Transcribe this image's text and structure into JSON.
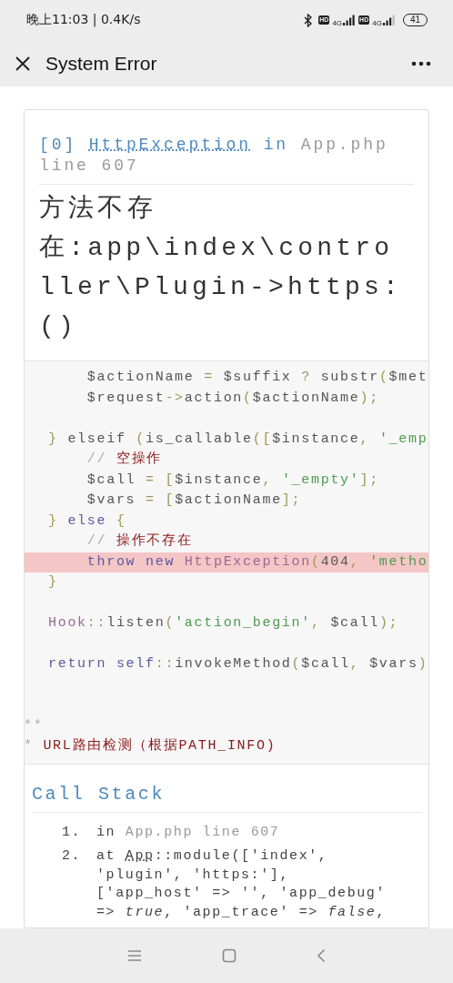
{
  "status_bar": {
    "text": "晚上11:03 | 0.4K/s",
    "sims": [
      {
        "badge": "HD",
        "network": "4G"
      },
      {
        "badge": "HD",
        "network": "4G"
      }
    ],
    "battery": "41"
  },
  "title_bar": {
    "title": "System Error"
  },
  "exception": {
    "index": "[0]",
    "class": "HttpException",
    "connector": "in",
    "location": "App.php line 607"
  },
  "message": "方法不存在:app\\index\\controller\\Plugin->https:()",
  "code": {
    "lines": [
      {
        "highlighted": false,
        "tokens": [
          {
            "kind": "plain",
            "text": "    $actionName"
          },
          {
            "kind": "punct",
            "text": " = "
          },
          {
            "kind": "plain",
            "text": "$suffix"
          },
          {
            "kind": "punct",
            "text": " ? "
          },
          {
            "kind": "plain",
            "text": "substr"
          },
          {
            "kind": "punct",
            "text": "("
          },
          {
            "kind": "plain",
            "text": "$met"
          }
        ]
      },
      {
        "highlighted": false,
        "tokens": [
          {
            "kind": "plain",
            "text": "    $request"
          },
          {
            "kind": "punct",
            "text": "->"
          },
          {
            "kind": "plain",
            "text": "action"
          },
          {
            "kind": "punct",
            "text": "("
          },
          {
            "kind": "plain",
            "text": "$actionName"
          },
          {
            "kind": "punct",
            "text": ");"
          }
        ]
      },
      {
        "highlighted": false
      },
      {
        "highlighted": false,
        "tokens": [
          {
            "kind": "punct",
            "text": "} "
          },
          {
            "kind": "plain",
            "text": "elseif "
          },
          {
            "kind": "punct",
            "text": "("
          },
          {
            "kind": "plain",
            "text": "is_callable"
          },
          {
            "kind": "punct",
            "text": "(["
          },
          {
            "kind": "plain",
            "text": "$instance"
          },
          {
            "kind": "punct",
            "text": ", "
          },
          {
            "kind": "string",
            "text": "'_emp"
          }
        ]
      },
      {
        "highlighted": false,
        "tokens": [
          {
            "kind": "comment_mark",
            "text": "    // "
          },
          {
            "kind": "comment",
            "text": "空操作"
          }
        ]
      },
      {
        "highlighted": false,
        "tokens": [
          {
            "kind": "plain",
            "text": "    $call"
          },
          {
            "kind": "punct",
            "text": " = ["
          },
          {
            "kind": "plain",
            "text": "$instance"
          },
          {
            "kind": "punct",
            "text": ", "
          },
          {
            "kind": "string",
            "text": "'_empty'"
          },
          {
            "kind": "punct",
            "text": "];"
          }
        ]
      },
      {
        "highlighted": false,
        "tokens": [
          {
            "kind": "plain",
            "text": "    $vars"
          },
          {
            "kind": "punct",
            "text": " = ["
          },
          {
            "kind": "plain",
            "text": "$actionName"
          },
          {
            "kind": "punct",
            "text": "];"
          }
        ]
      },
      {
        "highlighted": false,
        "tokens": [
          {
            "kind": "punct",
            "text": "} "
          },
          {
            "kind": "keyword",
            "text": "else"
          },
          {
            "kind": "punct",
            "text": " {"
          }
        ]
      },
      {
        "highlighted": false,
        "tokens": [
          {
            "kind": "comment_mark",
            "text": "    // "
          },
          {
            "kind": "comment",
            "text": "操作不存在"
          }
        ]
      },
      {
        "highlighted": true,
        "tokens": [
          {
            "kind": "keyword",
            "text": "    throw new "
          },
          {
            "kind": "class",
            "text": "HttpException"
          },
          {
            "kind": "punct",
            "text": "("
          },
          {
            "kind": "plain",
            "text": "404"
          },
          {
            "kind": "punct",
            "text": ", "
          },
          {
            "kind": "string",
            "text": "'metho"
          }
        ]
      },
      {
        "highlighted": false,
        "tokens": [
          {
            "kind": "punct",
            "text": "}"
          }
        ]
      },
      {
        "highlighted": false
      },
      {
        "highlighted": false,
        "tokens": [
          {
            "kind": "class",
            "text": "Hook"
          },
          {
            "kind": "punct",
            "text": "::"
          },
          {
            "kind": "plain",
            "text": "listen"
          },
          {
            "kind": "punct",
            "text": "("
          },
          {
            "kind": "string",
            "text": "'action_begin'"
          },
          {
            "kind": "punct",
            "text": ", "
          },
          {
            "kind": "plain",
            "text": "$call"
          },
          {
            "kind": "punct",
            "text": ");"
          }
        ]
      },
      {
        "highlighted": false
      },
      {
        "highlighted": false,
        "tokens": [
          {
            "kind": "keyword",
            "text": "return self"
          },
          {
            "kind": "punct",
            "text": "::"
          },
          {
            "kind": "plain",
            "text": "invokeMethod"
          },
          {
            "kind": "punct",
            "text": "("
          },
          {
            "kind": "plain",
            "text": "$call"
          },
          {
            "kind": "punct",
            "text": ", "
          },
          {
            "kind": "plain",
            "text": "$vars"
          },
          {
            "kind": "punct",
            "text": ")"
          }
        ]
      },
      {
        "highlighted": false
      },
      {
        "highlighted": false
      },
      {
        "highlighted": false,
        "outdent": true,
        "tokens": [
          {
            "kind": "comment_mark",
            "text": "**"
          }
        ]
      },
      {
        "highlighted": false,
        "outdent": true,
        "tokens": [
          {
            "kind": "comment_mark",
            "text": "* "
          },
          {
            "kind": "comment",
            "text": "URL路由检测（根据PATH_INFO)"
          }
        ]
      }
    ]
  },
  "call_stack": {
    "title": "Call Stack",
    "items": [
      {
        "number": "1.",
        "kind": "location",
        "keyword": "in",
        "text": "App.php line 607"
      },
      {
        "number": "2.",
        "kind": "call",
        "keyword": "at",
        "class": "App",
        "text": "::module(['index', 'plugin', 'https:'], ['app_host' => '', 'app_debug' => *true*, 'app_trace' => *false*,"
      }
    ]
  }
}
